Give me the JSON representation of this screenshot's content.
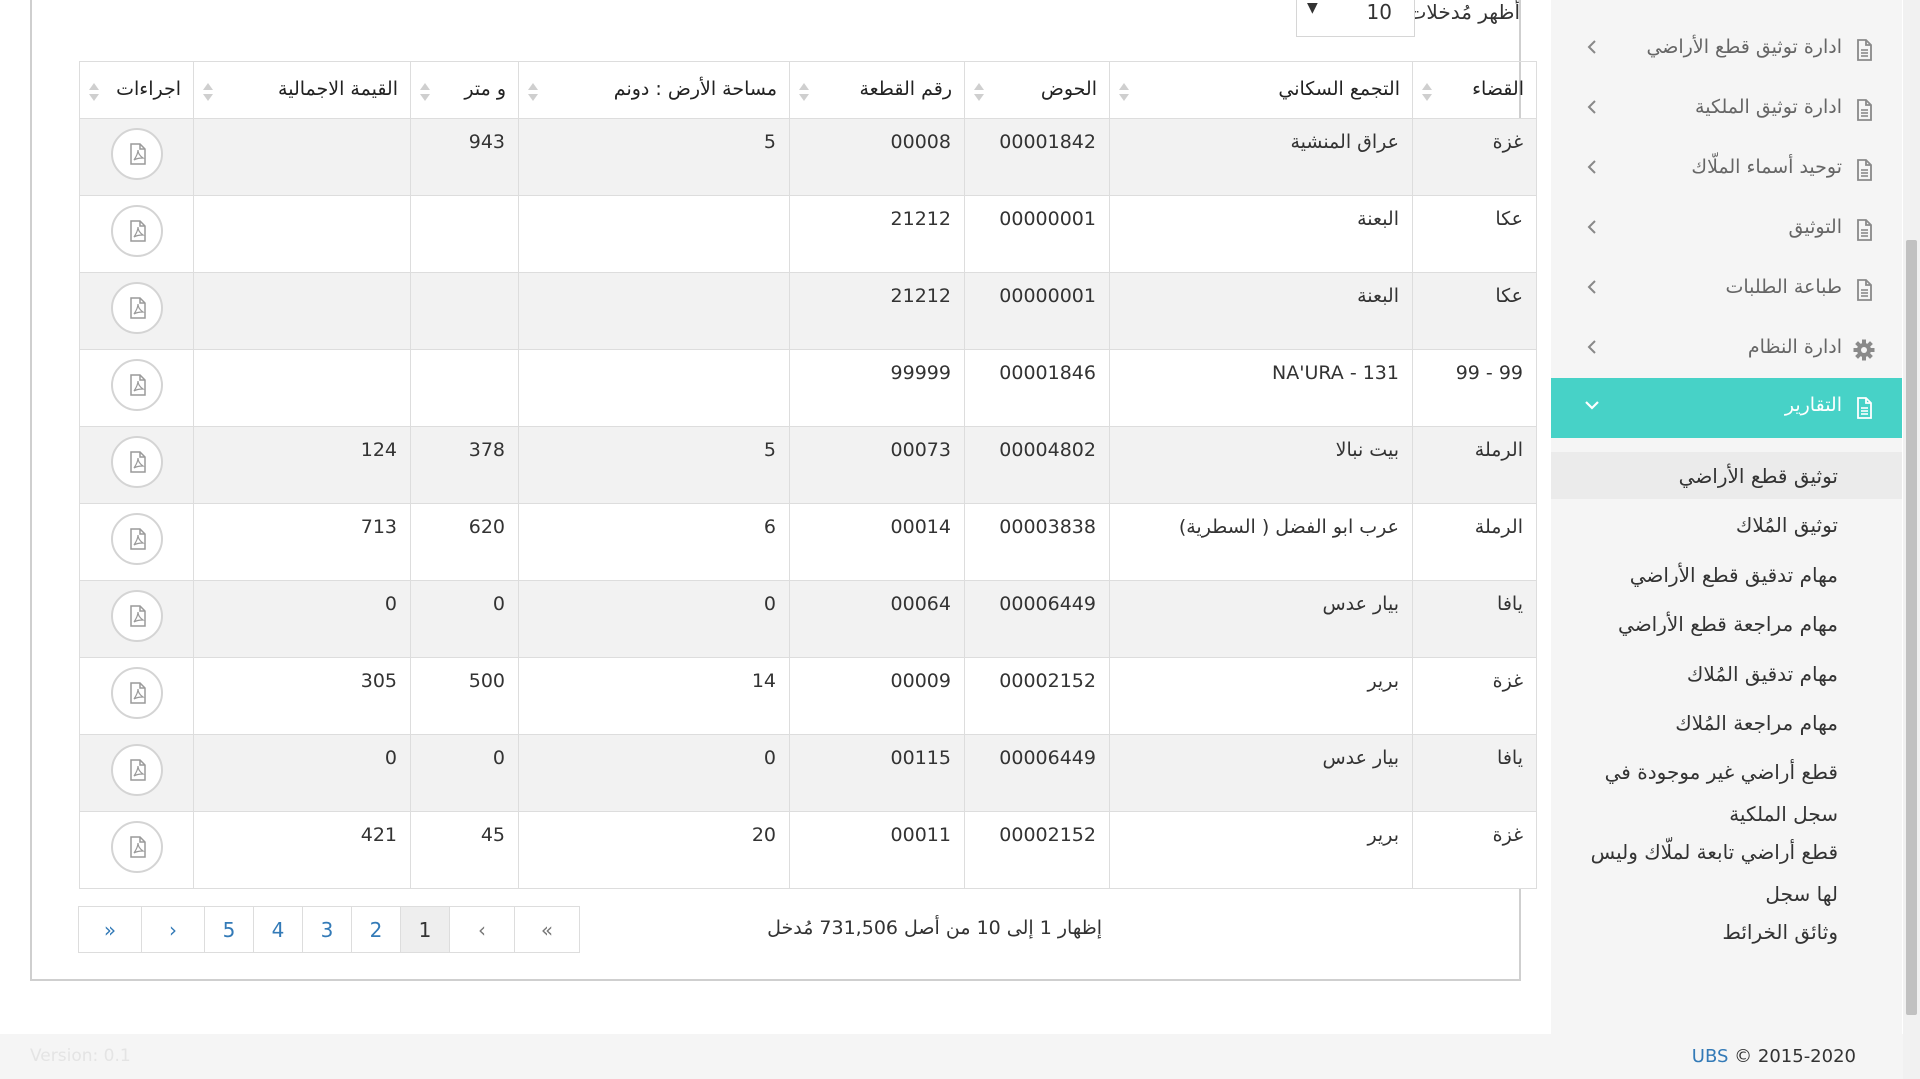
{
  "sidebar": {
    "items": [
      {
        "label": "ادارة توثيق قطع الأراضي",
        "icon": "document-icon"
      },
      {
        "label": "ادارة توثيق الملكية",
        "icon": "document-icon"
      },
      {
        "label": "توحيد أسماء الملّاك",
        "icon": "document-icon"
      },
      {
        "label": "التوثيق",
        "icon": "document-icon"
      },
      {
        "label": "طباعة الطلبات",
        "icon": "document-icon"
      },
      {
        "label": "ادارة النظام",
        "icon": "gear-icon"
      },
      {
        "label": "التقارير",
        "icon": "document-icon",
        "active": true
      }
    ],
    "subitems": [
      {
        "label": "توثيق قطع الأراضي",
        "selected": true
      },
      {
        "label": "توثيق المُلاك"
      },
      {
        "label": "مهام تدقيق قطع الأراضي"
      },
      {
        "label": "مهام مراجعة قطع الأراضي"
      },
      {
        "label": "مهام تدقيق المُلاك"
      },
      {
        "label": "مهام مراجعة المُلاك"
      },
      {
        "label": "قطع أراضي غير موجودة في",
        "label2": "سجل الملكية"
      },
      {
        "label": "قطع أراضي تابعة لملّاك وليس",
        "label2": "لها سجل"
      },
      {
        "label": "وثائق الخرائط"
      }
    ],
    "active_color": "#47d2c7"
  },
  "table_controls": {
    "length_label": "أظهر مُدخلات",
    "length_value": "10",
    "length_arrow": "▼"
  },
  "table": {
    "columns": [
      "القضاء",
      "التجمع السكاني",
      "الحوض",
      "رقم القطعة",
      "مساحة الأرض : دونم",
      "و متر",
      "القيمة الاجمالية",
      "اجراءات"
    ],
    "rows": [
      [
        "غزة",
        "عراق المنشية",
        "00001842",
        "00008",
        "5",
        "943",
        ""
      ],
      [
        "عكا",
        "البعنة",
        "00000001",
        "21212",
        "",
        "",
        ""
      ],
      [
        "عكا",
        "البعنة",
        "00000001",
        "21212",
        "",
        "",
        ""
      ],
      [
        "99 - 99",
        "NA'URA - 131",
        "00001846",
        "99999",
        "",
        "",
        ""
      ],
      [
        "الرملة",
        "بيت نبالا",
        "00004802",
        "00073",
        "5",
        "378",
        "124"
      ],
      [
        "الرملة",
        "عرب ابو الفضل ( السطرية)",
        "00003838",
        "00014",
        "6",
        "620",
        "713"
      ],
      [
        "يافا",
        "بيار عدس",
        "00006449",
        "00064",
        "0",
        "0",
        "0"
      ],
      [
        "غزة",
        "برير",
        "00002152",
        "00009",
        "14",
        "500",
        "305"
      ],
      [
        "يافا",
        "بيار عدس",
        "00006449",
        "00115",
        "0",
        "0",
        "0"
      ],
      [
        "غزة",
        "برير",
        "00002152",
        "00011",
        "20",
        "45",
        "421"
      ]
    ],
    "action_icon": "pdf-file-icon"
  },
  "info": "إظهار 1 إلى 10 من أصل 731,506 مُدخل",
  "pagination": {
    "first": "«",
    "prev": "‹",
    "pages": [
      "1",
      "2",
      "3",
      "4",
      "5"
    ],
    "current": "1",
    "next": "›",
    "last": "»"
  },
  "footer": {
    "version": "Version: 0.1",
    "copyright_brand": "UBS",
    "copyright_text": " © 2015-2020"
  }
}
